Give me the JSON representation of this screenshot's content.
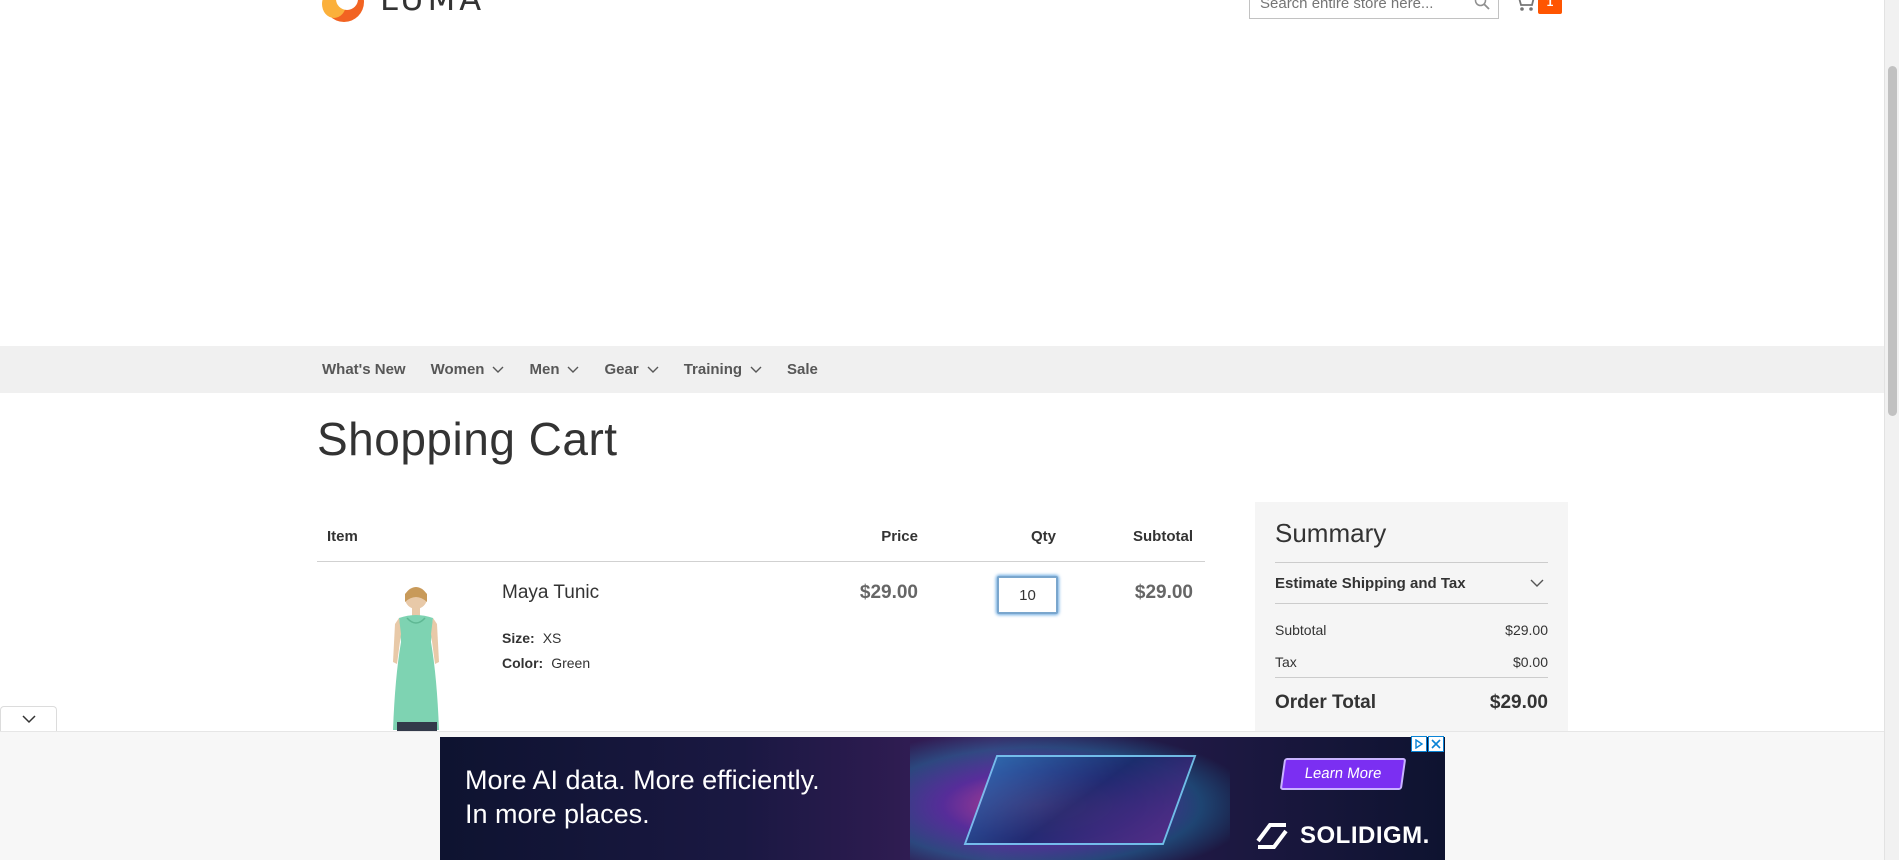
{
  "header": {
    "logo_text": "LUMA",
    "search_placeholder": "Search entire store here...",
    "cart_count": "1"
  },
  "nav": {
    "items": [
      {
        "label": "What's New",
        "has_dropdown": false
      },
      {
        "label": "Women",
        "has_dropdown": true
      },
      {
        "label": "Men",
        "has_dropdown": true
      },
      {
        "label": "Gear",
        "has_dropdown": true
      },
      {
        "label": "Training",
        "has_dropdown": true
      },
      {
        "label": "Sale",
        "has_dropdown": false
      }
    ]
  },
  "page": {
    "title": "Shopping Cart"
  },
  "cart": {
    "columns": {
      "item": "Item",
      "price": "Price",
      "qty": "Qty",
      "subtotal": "Subtotal"
    },
    "rows": [
      {
        "name": "Maya Tunic",
        "options": [
          {
            "label": "Size:",
            "value": "XS"
          },
          {
            "label": "Color:",
            "value": "Green"
          }
        ],
        "price": "$29.00",
        "qty": "10",
        "subtotal": "$29.00"
      }
    ]
  },
  "summary": {
    "title": "Summary",
    "shipping_label": "Estimate Shipping and Tax",
    "subtotal_label": "Subtotal",
    "subtotal_value": "$29.00",
    "tax_label": "Tax",
    "tax_value": "$0.00",
    "total_label": "Order Total",
    "total_value": "$29.00"
  },
  "ad": {
    "headline_line1": "More AI data. More efficiently.",
    "headline_line2": "In more places.",
    "cta": "Learn More",
    "brand": "SOLIDIGM."
  },
  "colors": {
    "accent": "#ff5501",
    "nav_bg": "#f0f0f0",
    "summary_bg": "#f5f5f5",
    "ad_cta": "#7b2ff2"
  }
}
